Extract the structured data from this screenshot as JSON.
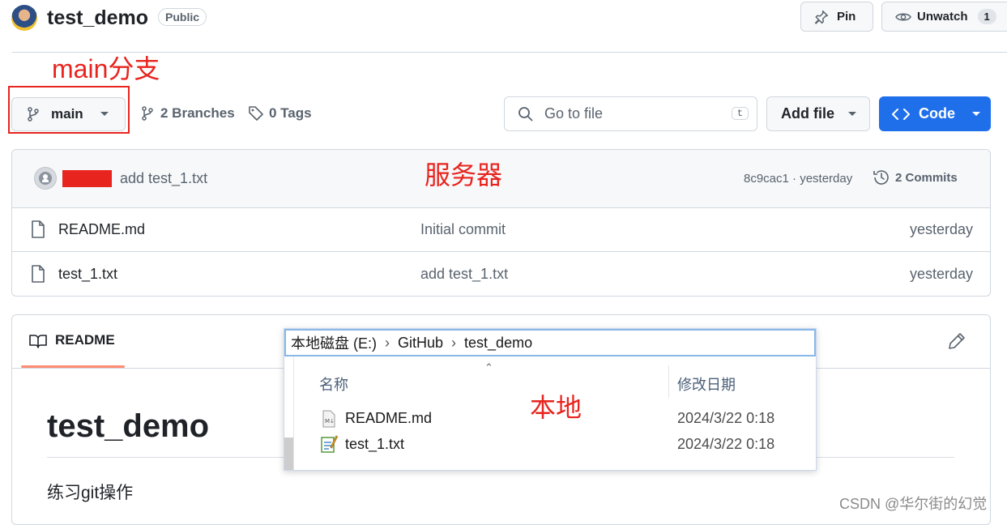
{
  "repo": {
    "name": "test_demo",
    "visibility": "Public"
  },
  "header": {
    "pin_label": "Pin",
    "unwatch_label": "Unwatch",
    "unwatch_count": "1"
  },
  "annotations": {
    "main_branch": "main分支",
    "server": "服务器",
    "local": "本地"
  },
  "toolbar": {
    "branch": "main",
    "branches": "2 Branches",
    "tags": "0 Tags",
    "goto_placeholder": "Go to file",
    "goto_shortcut": "t",
    "add_file": "Add file",
    "code": "Code"
  },
  "commit": {
    "message": "add test_1.txt",
    "hash": "8c9cac1 · yesterday",
    "commits": "2 Commits"
  },
  "files": [
    {
      "name": "README.md",
      "message": "Initial commit",
      "time": "yesterday"
    },
    {
      "name": "test_1.txt",
      "message": "add test_1.txt",
      "time": "yesterday"
    }
  ],
  "readme": {
    "tab": "README",
    "title": "test_demo",
    "body": "练习git操作"
  },
  "explorer": {
    "breadcrumb": [
      "本地磁盘 (E:)",
      "GitHub",
      "test_demo"
    ],
    "col_name": "名称",
    "col_date": "修改日期",
    "files": [
      {
        "name": "README.md",
        "date": "2024/3/22 0:18"
      },
      {
        "name": "test_1.txt",
        "date": "2024/3/22 0:18"
      }
    ]
  },
  "watermark": "CSDN @华尔街的幻觉"
}
